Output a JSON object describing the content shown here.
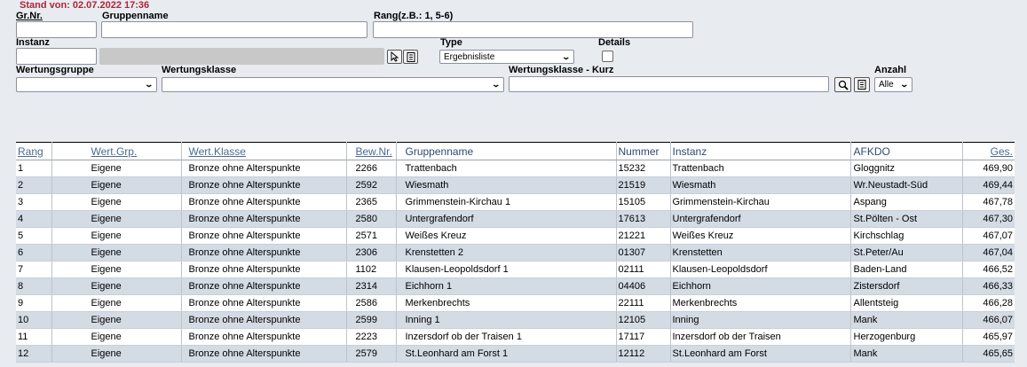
{
  "header": {
    "stand": "Stand von: 02.07.2022 17:36"
  },
  "filters": {
    "grnr_label": "Gr.Nr.",
    "gruppenname_label": "Gruppenname",
    "rang_label": "Rang(z.B.: 1, 5-6)",
    "instanz_label": "Instanz",
    "type_label": "Type",
    "type_value": "Ergebnisliste",
    "details_label": "Details",
    "wertungsgruppe_label": "Wertungsgruppe",
    "wertungsklasse_label": "Wertungsklasse",
    "wertungsklasse_kurz_label": "Wertungsklasse - Kurz",
    "anzahl_label": "Anzahl",
    "anzahl_value": "Alle"
  },
  "icons": {
    "instanz_pick": "cursor-pick-icon",
    "instanz_list": "list-icon",
    "search": "magnifier-icon",
    "kurz_list": "list-icon"
  },
  "table": {
    "columns": [
      "Rang",
      "Wert.Grp.",
      "Wert.Klasse",
      "Bew.Nr.",
      "Gruppenname",
      "Nummer",
      "Instanz",
      "AFKDO",
      "Ges."
    ],
    "rows": [
      [
        "1",
        "Eigene",
        "Bronze ohne Alterspunkte",
        "2266",
        "Trattenbach",
        "15232",
        "Trattenbach",
        "Gloggnitz",
        "469,90"
      ],
      [
        "2",
        "Eigene",
        "Bronze ohne Alterspunkte",
        "2592",
        "Wiesmath",
        "21519",
        "Wiesmath",
        "Wr.Neustadt-Süd",
        "469,44"
      ],
      [
        "3",
        "Eigene",
        "Bronze ohne Alterspunkte",
        "2365",
        "Grimmenstein-Kirchau 1",
        "15105",
        "Grimmenstein-Kirchau",
        "Aspang",
        "467,78"
      ],
      [
        "4",
        "Eigene",
        "Bronze ohne Alterspunkte",
        "2580",
        "Untergrafendorf",
        "17613",
        "Untergrafendorf",
        "St.Pölten - Ost",
        "467,30"
      ],
      [
        "5",
        "Eigene",
        "Bronze ohne Alterspunkte",
        "2571",
        "Weißes Kreuz",
        "21221",
        "Weißes Kreuz",
        "Kirchschlag",
        "467,07"
      ],
      [
        "6",
        "Eigene",
        "Bronze ohne Alterspunkte",
        "2306",
        "Krenstetten 2",
        "01307",
        "Krenstetten",
        "St.Peter/Au",
        "467,04"
      ],
      [
        "7",
        "Eigene",
        "Bronze ohne Alterspunkte",
        "1102",
        "Klausen-Leopoldsdorf 1",
        "02111",
        "Klausen-Leopoldsdorf",
        "Baden-Land",
        "466,52"
      ],
      [
        "8",
        "Eigene",
        "Bronze ohne Alterspunkte",
        "2314",
        "Eichhorn 1",
        "04406",
        "Eichhorn",
        "Zistersdorf",
        "466,33"
      ],
      [
        "9",
        "Eigene",
        "Bronze ohne Alterspunkte",
        "2586",
        "Merkenbrechts",
        "22111",
        "Merkenbrechts",
        "Allentsteig",
        "466,28"
      ],
      [
        "10",
        "Eigene",
        "Bronze ohne Alterspunkte",
        "2599",
        "Inning 1",
        "12105",
        "Inning",
        "Mank",
        "466,07"
      ],
      [
        "11",
        "Eigene",
        "Bronze ohne Alterspunkte",
        "2223",
        "Inzersdorf ob der Traisen 1",
        "17117",
        "Inzersdorf ob der Traisen",
        "Herzogenburg",
        "465,97"
      ],
      [
        "12",
        "Eigene",
        "Bronze ohne Alterspunkte",
        "2579",
        "St.Leonhard am Forst 1",
        "12112",
        "St.Leonhard am Forst",
        "Mank",
        "465,65"
      ]
    ]
  }
}
